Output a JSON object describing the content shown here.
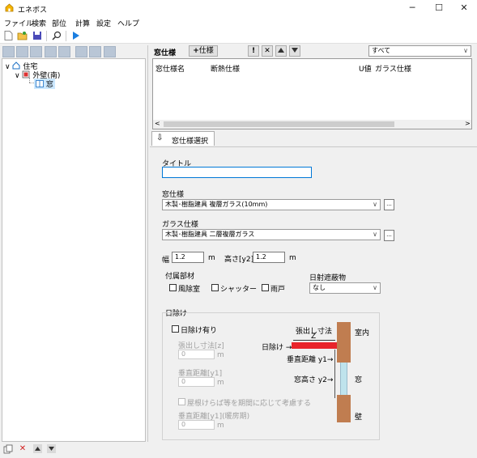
{
  "window": {
    "title": "エネボス",
    "minimize_label": "─",
    "maximize_label": "☐",
    "close_label": "✕"
  },
  "menu": [
    "ファイル",
    "検索",
    "部位",
    "計算",
    "設定",
    "ヘルプ"
  ],
  "toolbar": {
    "icons": [
      "new-file-icon",
      "open-folder-icon",
      "save-icon",
      "search-icon",
      "run-icon"
    ]
  },
  "tree": {
    "root": "住宅",
    "child": "外壁(南)",
    "leaf": "窓"
  },
  "window_spec": {
    "header_label": "窓仕様",
    "add_button_label": "仕様",
    "filter_value": "すべて",
    "columns": [
      "窓仕様名",
      "断熱仕様",
      "U値",
      "ガラス仕様"
    ],
    "tab_label": "窓仕様選択"
  },
  "form": {
    "title_label": "タイトル",
    "title_value": "",
    "window_spec_label": "窓仕様",
    "window_spec_value": "木製･樹脂建具 複層ガラス(10mm)",
    "glass_spec_label": "ガラス仕様",
    "glass_spec_value": "木製･樹脂建具 二層複層ガラス",
    "width_label": "幅",
    "width_value": "1.2",
    "width_unit": "m",
    "height_label": "高さ[y2]",
    "height_value": "1.2",
    "height_unit": "m",
    "attachments_label": "付属部材",
    "attachments": [
      "風除室",
      "シャッター",
      "雨戸"
    ],
    "shading_label": "日射遮蔽物",
    "shading_value": "なし"
  },
  "eaves": {
    "group_label": "日除け",
    "has_eaves_label": "日除け有り",
    "overhang_label": "張出し寸法[z]",
    "overhang_value": "0",
    "vert_dist_label": "垂直距離[y1]",
    "vert_dist_value": "0",
    "consider_label": "屋根けらば等を期間に応じて考慮する",
    "vert_dist_cooling_label": "垂直距離[y1](暖房期)",
    "vert_dist_cooling_value": "0",
    "unit": "m",
    "diagram": {
      "overhang_caption": "張出し寸法",
      "z_label": "Z",
      "eaves_caption": "日除け →",
      "vert_dist_caption": "垂直距離 y1→",
      "window_height_caption": "窓高さ y2→",
      "indoor_label": "室内",
      "window_label": "窓",
      "wall_label": "壁"
    },
    "colors": {
      "eaves": "#e8232a",
      "wall": "#c07d50",
      "window": "#bfe3ec"
    }
  }
}
